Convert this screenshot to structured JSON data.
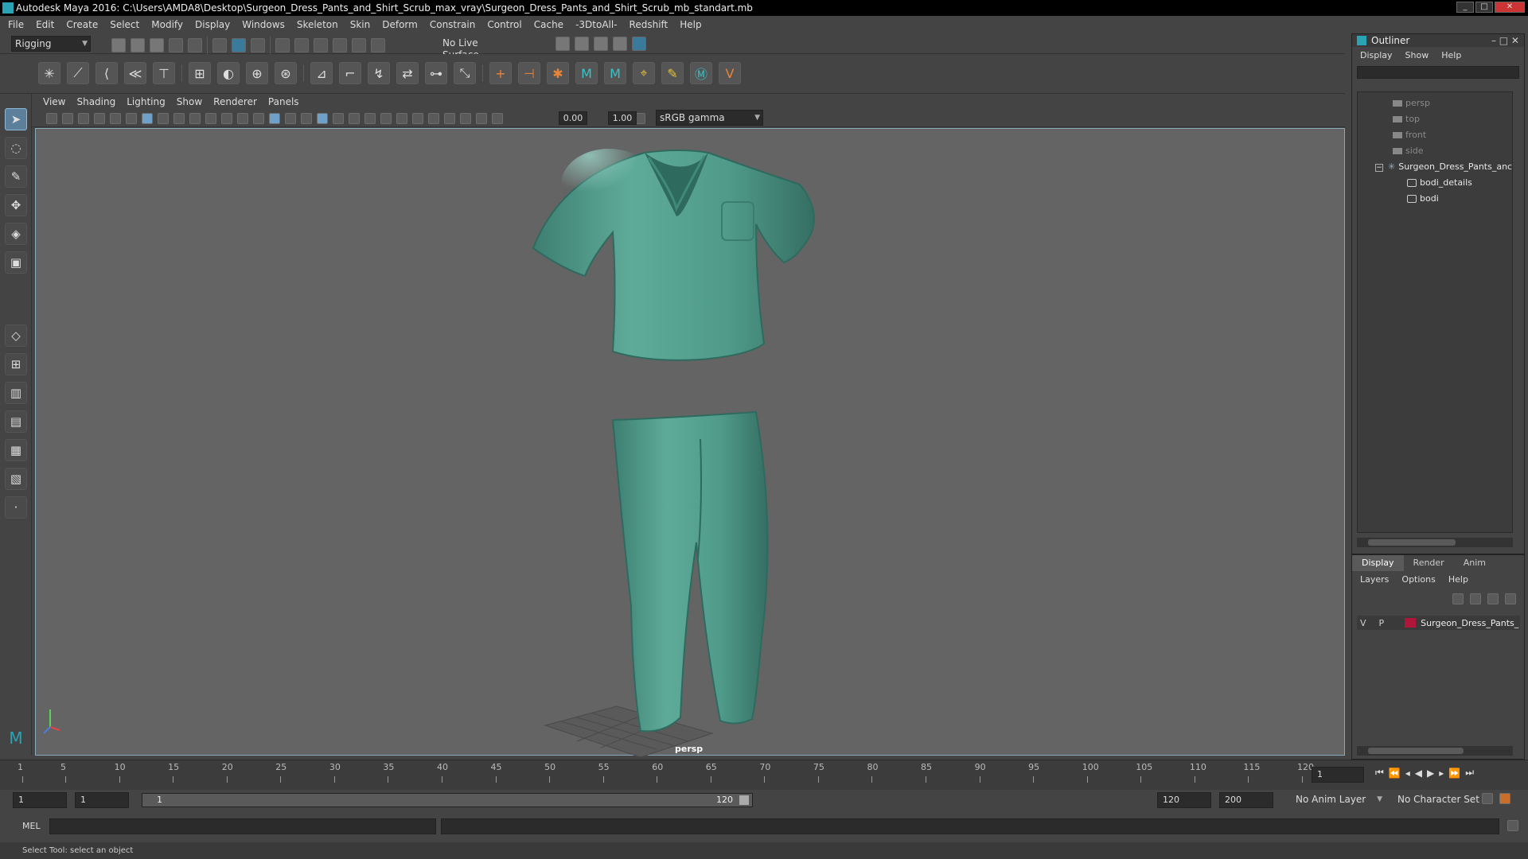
{
  "window": {
    "title": "Autodesk Maya 2016: C:\\Users\\AMDA8\\Desktop\\Surgeon_Dress_Pants_and_Shirt_Scrub_max_vray\\Surgeon_Dress_Pants_and_Shirt_Scrub_mb_standart.mb"
  },
  "menubar": [
    "File",
    "Edit",
    "Create",
    "Select",
    "Modify",
    "Display",
    "Windows",
    "Skeleton",
    "Skin",
    "Deform",
    "Constrain",
    "Control",
    "Cache",
    "-3DtoAll-",
    "Redshift",
    "Help"
  ],
  "statusline": {
    "mode": "Rigging",
    "live_surface": "No Live Surface"
  },
  "panel": {
    "menus": [
      "View",
      "Shading",
      "Lighting",
      "Show",
      "Renderer",
      "Panels"
    ],
    "near_value": "0.00",
    "far_value": "1.00",
    "color_space": "sRGB gamma",
    "camera_label": "persp"
  },
  "outliner": {
    "title": "Outliner",
    "menus": [
      "Display",
      "Show",
      "Help"
    ],
    "items": [
      {
        "label": "persp"
      },
      {
        "label": "top"
      },
      {
        "label": "front"
      },
      {
        "label": "side"
      },
      {
        "label": "Surgeon_Dress_Pants_anc"
      },
      {
        "label": "bodi_details"
      },
      {
        "label": "bodi"
      }
    ]
  },
  "layers": {
    "tabs": [
      "Display",
      "Render",
      "Anim"
    ],
    "menus": [
      "Layers",
      "Options",
      "Help"
    ],
    "row": {
      "v": "V",
      "p": "P",
      "name": "Surgeon_Dress_Pants_",
      "color": "#b0163a"
    }
  },
  "timeline": {
    "ticks": [
      "1",
      "5",
      "10",
      "15",
      "20",
      "25",
      "30",
      "35",
      "40",
      "45",
      "50",
      "55",
      "60",
      "65",
      "70",
      "75",
      "80",
      "85",
      "90",
      "95",
      "100",
      "105",
      "110",
      "115",
      "120"
    ],
    "current_frame": "1"
  },
  "range": {
    "start": "1",
    "playback_start": "1",
    "slider_start": "1",
    "slider_end": "120",
    "playback_end": "120",
    "end": "200",
    "anim_layer": "No Anim Layer",
    "character_set": "No Character Set"
  },
  "mel": {
    "label": "MEL"
  },
  "status": {
    "help_line": "Select Tool: select an object"
  },
  "colors": {
    "garment": "#4f9a8a",
    "viewport_bg": "#646464"
  }
}
